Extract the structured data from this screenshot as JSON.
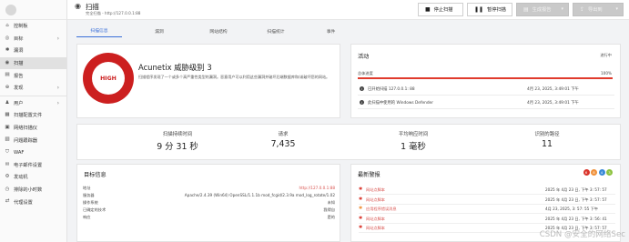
{
  "sidebar": {
    "items": [
      {
        "label": "控制板",
        "icon": "dashboard-icon",
        "glyph": "⌂"
      },
      {
        "label": "目标",
        "icon": "target-icon",
        "glyph": "◎",
        "chevron": "›"
      },
      {
        "label": "漏洞",
        "icon": "bug-icon",
        "glyph": "✱"
      },
      {
        "label": "扫描",
        "icon": "radar-icon",
        "glyph": "◉"
      },
      {
        "label": "报告",
        "icon": "report-icon",
        "glyph": "▤"
      },
      {
        "label": "发现",
        "icon": "discovery-icon",
        "glyph": "⊕",
        "chevron": "›"
      },
      {
        "label": "用户",
        "icon": "users-icon",
        "glyph": "♟",
        "chevron": "›"
      },
      {
        "label": "扫描配置文件",
        "icon": "scan-profile-icon",
        "glyph": "▦"
      },
      {
        "label": "网络扫描仪",
        "icon": "network-scanner-icon",
        "glyph": "▣"
      },
      {
        "label": "问题跟踪器",
        "icon": "issue-tracker-icon",
        "glyph": "▧"
      },
      {
        "label": "WAF",
        "icon": "waf-icon",
        "glyph": "⛉"
      },
      {
        "label": "电子邮件设置",
        "icon": "email-icon",
        "glyph": "✉"
      },
      {
        "label": "发动机",
        "icon": "engine-icon",
        "glyph": "⚙"
      },
      {
        "label": "排除的小时数",
        "icon": "clock-icon",
        "glyph": "◷"
      },
      {
        "label": "代理设置",
        "icon": "proxy-icon",
        "glyph": "⇄"
      }
    ]
  },
  "header": {
    "title": "扫描",
    "subtitle": "完全扫描 - http://127.0.0.1:88",
    "buttons": [
      {
        "label": "停止扫描",
        "icon": "stop-icon",
        "glyph": "■"
      },
      {
        "label": "暂停扫描",
        "icon": "pause-icon",
        "glyph": "❚❚"
      },
      {
        "label": "生成报告",
        "icon": "report-gen-icon",
        "glyph": "▤",
        "dropdown": "▾"
      },
      {
        "label": "导出到",
        "icon": "export-icon",
        "glyph": "⇪",
        "dropdown": "▾"
      }
    ]
  },
  "tabs": [
    "扫描信息",
    "漏洞",
    "网站结构",
    "扫描统计",
    "事件"
  ],
  "threat": {
    "badge": "HIGH",
    "title": "Acunetix 威胁级别 3",
    "description": "扫描程序发现了一个或多个高严重性类型的漏洞。恶意用户可以利用这些漏洞并破坏后端数据库和/或破坏您的网站。"
  },
  "activity": {
    "title": "活动",
    "status": "进行中",
    "progress_label": "总体进度",
    "progress_value": "100%",
    "progress_fraction": 1.0,
    "events": [
      {
        "text": "已开始扫描 127.0.0.1: 88",
        "date": "4月 23, 2025, 3:49:01 下午"
      },
      {
        "text": "此扫描中使用的 Windows Defender",
        "date": "4月 23, 2025, 3:49:01 下午"
      }
    ]
  },
  "stats": [
    {
      "label": "扫描持续时间",
      "value": "9 分 31 秒"
    },
    {
      "label": "请求",
      "value": "7,435"
    },
    {
      "label": "平均响应时间",
      "value": "1 毫秒"
    },
    {
      "label": "识别的路径",
      "value": "11"
    }
  ],
  "target_info": {
    "title": "目标信息",
    "rows": [
      {
        "key": "地址",
        "value": "http://127.0.0.1:88",
        "link": true
      },
      {
        "key": "服务器",
        "value": "Apache/2.4.39 (Win64) OpenSSL/1.1.1b mod_fcgid/2.3.9a mod_log_rotate/1.02"
      },
      {
        "key": "操作系统",
        "value": "未知"
      },
      {
        "key": "已确定的技术",
        "value": "我得自"
      },
      {
        "key": "响应",
        "value": "是的"
      }
    ]
  },
  "alerts": {
    "title": "最新警报",
    "counts": [
      {
        "value": "6",
        "color": "#d9342b"
      },
      {
        "value": "8",
        "color": "#f0913a"
      },
      {
        "value": "4",
        "color": "#3a8ad8"
      },
      {
        "value": "3",
        "color": "#8dc23f"
      }
    ],
    "items": [
      {
        "name": "网站点脚本",
        "date": "2025 年 4月 23 日, 下午 3: 57: 57",
        "color": "#d9342b"
      },
      {
        "name": "网站点脚本",
        "date": "2025 年 4月 23 日, 下午 3: 57: 57",
        "color": "#d9342b"
      },
      {
        "name": "应用程序错误消息",
        "date": "4月 23, 2025, 3: 57: 55 下午",
        "color": "#f0913a"
      },
      {
        "name": "网站点脚本",
        "date": "2025 年 4月 23 日, 下午 3: 56: 41",
        "color": "#d9342b"
      },
      {
        "name": "网站点脚本",
        "date": "2025 年 4月 23 日, 下午 3: 57: 57",
        "color": "#d9342b"
      }
    ]
  },
  "watermark": "CSDN @安全的网络Sec"
}
